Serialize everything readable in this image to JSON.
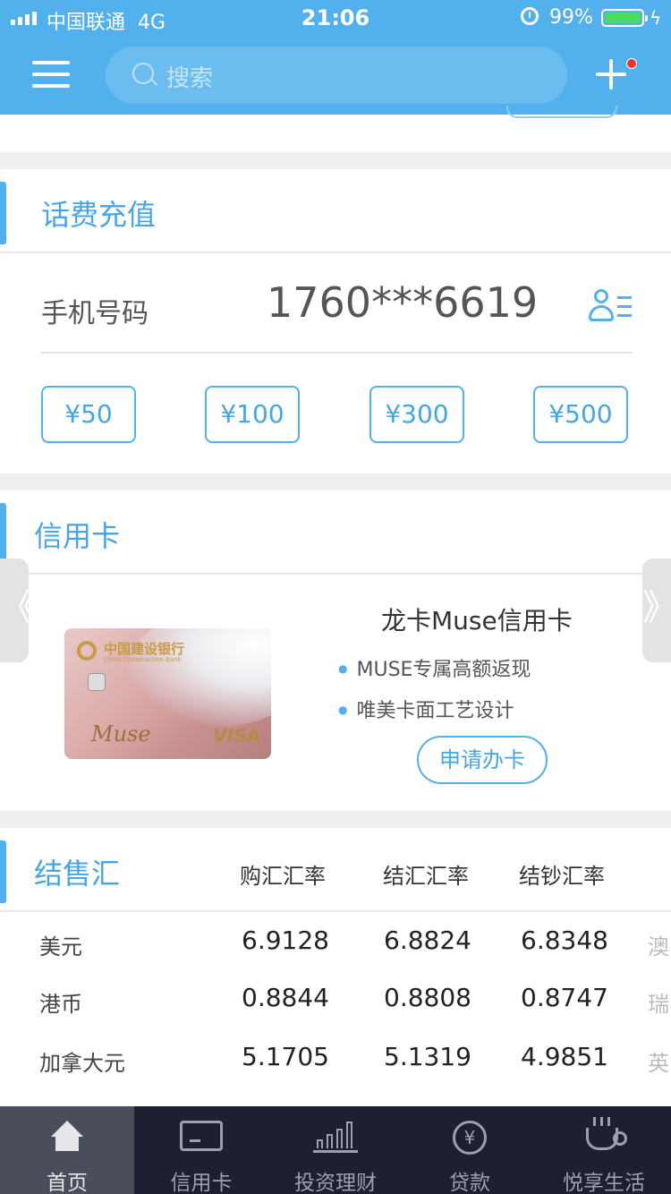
{
  "status_bar": {
    "carrier": "中国联通",
    "network": "4G",
    "time": "21:06",
    "battery": "99%"
  },
  "header": {
    "search_placeholder": "搜索"
  },
  "recharge": {
    "title": "话费充值",
    "phone_label": "手机号码",
    "phone_number": "1760***6619",
    "amounts": [
      "¥50",
      "¥100",
      "¥300",
      "¥500"
    ]
  },
  "credit_card": {
    "title": "信用卡",
    "nav_prev": "《",
    "nav_next": "》",
    "card_image": {
      "bank_name": "中国建设银行",
      "bank_name_en": "China Construction Bank",
      "brand": "Muse",
      "network": "VISA"
    },
    "card_name": "龙卡Muse信用卡",
    "features": [
      "MUSE专属高额返现",
      "唯美卡面工艺设计"
    ],
    "apply_label": "申请办卡"
  },
  "fx": {
    "title": "结售汇",
    "columns": [
      "购汇汇率",
      "结汇汇率",
      "结钞汇率"
    ],
    "rows": [
      {
        "currency": "美元",
        "buy": "6.9128",
        "sell": "6.8824",
        "cash": "6.8348",
        "next": "澳"
      },
      {
        "currency": "港币",
        "buy": "0.8844",
        "sell": "0.8808",
        "cash": "0.8747",
        "next": "瑞"
      },
      {
        "currency": "加拿大元",
        "buy": "5.1705",
        "sell": "5.1319",
        "cash": "4.9851",
        "next": "英"
      }
    ]
  },
  "tabbar": {
    "tabs": [
      {
        "label": "首页",
        "icon": "home-icon",
        "active": true
      },
      {
        "label": "信用卡",
        "icon": "credit-card-icon"
      },
      {
        "label": "投资理财",
        "icon": "bar-chart-icon"
      },
      {
        "label": "贷款",
        "icon": "yen-circle-icon"
      },
      {
        "label": "悦享生活",
        "icon": "coffee-cup-icon"
      }
    ]
  },
  "colors": {
    "primary": "#52b1ec",
    "tabbar_bg": "#1e2032",
    "tab_active_bg": "#4a4d5a",
    "notification_dot": "#f2302f"
  }
}
